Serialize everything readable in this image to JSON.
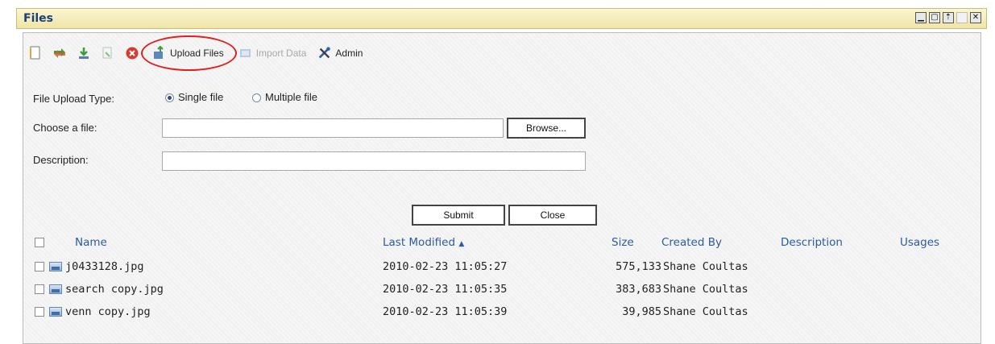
{
  "window": {
    "title": "Files",
    "controls": [
      "minimize-icon",
      "restore-icon",
      "pin-icon",
      "blank-icon",
      "close-icon"
    ]
  },
  "toolbar": {
    "icons": [
      "new-file-icon",
      "move-icon",
      "download-icon",
      "edit-icon",
      "delete-icon"
    ],
    "upload_label": "Upload Files",
    "import_label": "Import Data",
    "admin_label": "Admin"
  },
  "form": {
    "upload_type_label": "File Upload Type:",
    "single_label": "Single file",
    "multiple_label": "Multiple file",
    "selected_type": "Single file",
    "choose_label": "Choose a file:",
    "choose_value": "",
    "browse_label": "Browse...",
    "description_label": "Description:",
    "description_value": "",
    "submit_label": "Submit",
    "close_label": "Close"
  },
  "grid": {
    "headers": {
      "name": "Name",
      "modified": "Last Modified",
      "size": "Size",
      "created_by": "Created By",
      "description": "Description",
      "usages": "Usages"
    },
    "sort_indicator": "▲",
    "rows": [
      {
        "name": "j0433128.jpg",
        "modified": "2010-02-23 11:05:27",
        "size": "575,133",
        "created_by": "Shane Coultas"
      },
      {
        "name": "search copy.jpg",
        "modified": "2010-02-23 11:05:35",
        "size": "383,683",
        "created_by": "Shane Coultas"
      },
      {
        "name": "venn copy.jpg",
        "modified": "2010-02-23 11:05:39",
        "size": "39,985",
        "created_by": "Shane Coultas"
      }
    ]
  },
  "colors": {
    "title_bar": "#f3ebb8",
    "highlight_circle": "#e0201c",
    "header_link": "#2c5aa0"
  }
}
